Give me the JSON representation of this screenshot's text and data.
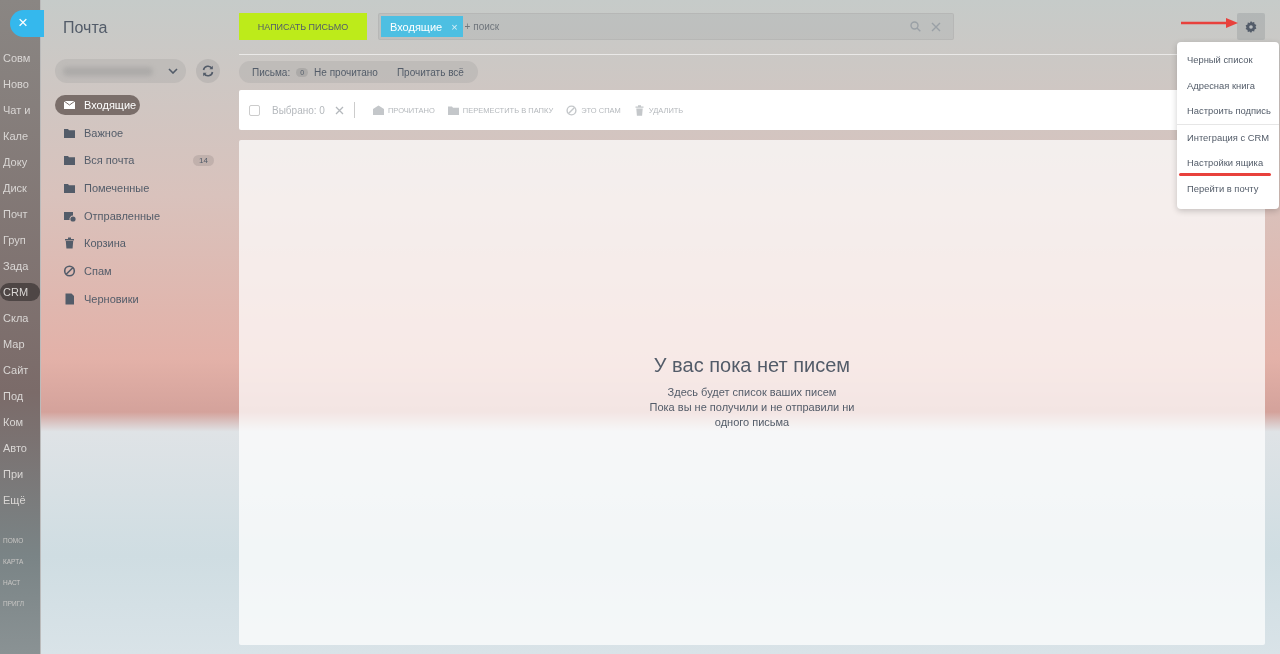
{
  "close_button": {
    "label": "×"
  },
  "background_nav": {
    "items": [
      {
        "label": "Совм",
        "selected": false
      },
      {
        "label": "Ново",
        "selected": false
      },
      {
        "label": "Чат и",
        "selected": false
      },
      {
        "label": "Кале",
        "selected": false
      },
      {
        "label": "Доку",
        "selected": false
      },
      {
        "label": "Диск",
        "selected": false
      },
      {
        "label": "Почт",
        "selected": false
      },
      {
        "label": "Груп",
        "selected": false
      },
      {
        "label": "Зада",
        "selected": false
      },
      {
        "label": "CRM",
        "selected": true
      },
      {
        "label": "Скла",
        "selected": false
      },
      {
        "label": "Мар",
        "selected": false
      },
      {
        "label": "Сайт",
        "selected": false
      },
      {
        "label": "Под",
        "selected": false
      },
      {
        "label": "Ком",
        "selected": false
      },
      {
        "label": "Авто",
        "selected": false
      },
      {
        "label": "При",
        "selected": false
      },
      {
        "label": "Ещё",
        "selected": false
      }
    ],
    "footer_links": [
      "ПОМО",
      "КАРТА",
      "НАСТ",
      "ПРИГЛ"
    ]
  },
  "mail": {
    "title": "Почта",
    "folders": [
      {
        "kind": "inbox",
        "label": "Входящие",
        "selected": true
      },
      {
        "kind": "folder",
        "label": "Важное",
        "selected": false
      },
      {
        "kind": "folder",
        "label": "Вся почта",
        "selected": false,
        "count": "14"
      },
      {
        "kind": "folder",
        "label": "Помеченные",
        "selected": false
      },
      {
        "kind": "sent",
        "label": "Отправленные",
        "selected": false
      },
      {
        "kind": "trash",
        "label": "Корзина",
        "selected": false
      },
      {
        "kind": "spam",
        "label": "Спам",
        "selected": false
      },
      {
        "kind": "draft",
        "label": "Черновики",
        "selected": false
      }
    ],
    "compose_button": "НАПИСАТЬ ПИСЬМО",
    "search": {
      "filter_tag": "Входящие",
      "tag_close": "×",
      "placeholder": "+ поиск"
    },
    "counter": {
      "label": "Письма:",
      "count": "0",
      "status": "Не прочитано",
      "action": "Прочитать всё"
    },
    "toolbar": {
      "checked": false,
      "selected_label": "Выбрано: 0",
      "actions": [
        {
          "kind": "read",
          "label": "ПРОЧИТАНО"
        },
        {
          "kind": "move",
          "label": "ПЕРЕМЕСТИТЬ В ПАПКУ"
        },
        {
          "kind": "spam",
          "label": "ЭТО СПАМ"
        },
        {
          "kind": "trash",
          "label": "УДАЛИТЬ"
        }
      ]
    },
    "empty_state": {
      "title": "У вас пока нет писем",
      "lines": [
        "Здесь будет список ваших писем",
        "Пока вы не получили и не отправили ни одного письма"
      ]
    },
    "settings_menu": {
      "groups": [
        [
          {
            "label": "Черный список",
            "annotated": false
          },
          {
            "label": "Адресная книга",
            "annotated": false
          },
          {
            "label": "Настроить подпись",
            "annotated": false
          }
        ],
        [
          {
            "label": "Интеграция с CRM",
            "annotated": false
          },
          {
            "label": "Настройки ящика",
            "annotated": true
          },
          {
            "label": "Перейти в почту",
            "annotated": false
          }
        ]
      ]
    }
  }
}
